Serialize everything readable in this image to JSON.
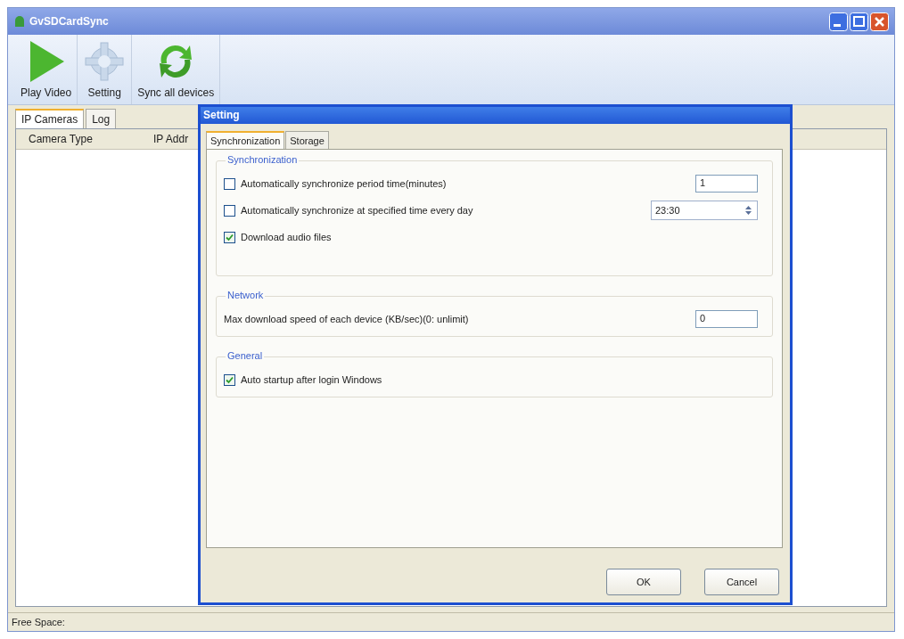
{
  "window": {
    "title": "GvSDCardSync"
  },
  "toolbar": [
    {
      "kind": "play",
      "label": "Play Video"
    },
    {
      "kind": "gear",
      "label": "Setting"
    },
    {
      "kind": "sync",
      "label": "Sync all devices"
    }
  ],
  "tabs": [
    {
      "label": "IP Cameras",
      "selected": true
    },
    {
      "label": "Log",
      "selected": false
    }
  ],
  "table": {
    "columns": [
      "Camera Type",
      "IP Addr"
    ]
  },
  "status_bar": "Free Space:",
  "dialog": {
    "title": "Setting",
    "tabs": [
      {
        "label": "Synchronization",
        "selected": true
      },
      {
        "label": "Storage",
        "selected": false
      }
    ],
    "groups": [
      {
        "legend": "Synchronization",
        "items": [
          {
            "kind": "check-field",
            "label": "Automatically synchronize period time(minutes)",
            "checked": false,
            "value": "1"
          },
          {
            "kind": "check-time",
            "label": "Automatically synchronize at specified time every day",
            "checked": false,
            "value": "23:30"
          },
          {
            "kind": "check",
            "label": "Download audio files",
            "checked": true
          }
        ]
      },
      {
        "legend": "Network",
        "items": [
          {
            "kind": "field",
            "label": "Max download speed of each device (KB/sec)(0: unlimit)",
            "value": "0"
          }
        ]
      },
      {
        "legend": "General",
        "items": [
          {
            "kind": "check",
            "label": "Auto startup after login Windows",
            "checked": true
          }
        ]
      }
    ],
    "buttons": [
      "OK",
      "Cancel"
    ]
  }
}
